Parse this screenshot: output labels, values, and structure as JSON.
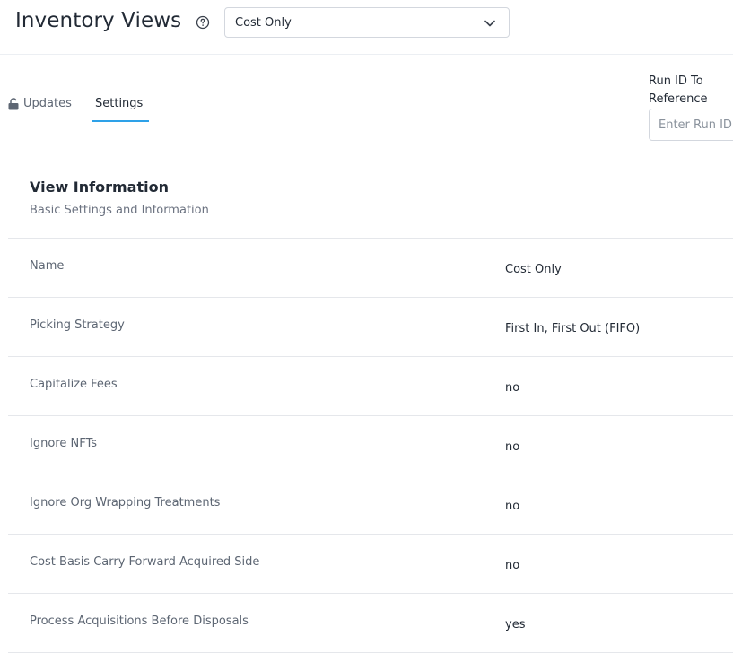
{
  "header": {
    "title": "Inventory Views",
    "help_icon": "question-circle-icon",
    "view_select": {
      "value": "Cost Only",
      "icon": "chevron-down-icon"
    }
  },
  "tabs": [
    {
      "label": "Updates",
      "icon": "lock-icon",
      "active": false
    },
    {
      "label": "Settings",
      "active": true
    }
  ],
  "run_id": {
    "label": "Run ID To Reference",
    "placeholder": "Enter Run ID"
  },
  "section": {
    "title": "View Information",
    "subtitle": "Basic Settings and Information"
  },
  "rows": [
    {
      "key": "Name",
      "value": "Cost Only"
    },
    {
      "key": "Picking Strategy",
      "value": "First In, First Out (FIFO)"
    },
    {
      "key": "Capitalize Fees",
      "value": "no"
    },
    {
      "key": "Ignore NFTs",
      "value": "no"
    },
    {
      "key": "Ignore Org Wrapping Treatments",
      "value": "no"
    },
    {
      "key": "Cost Basis Carry Forward Acquired Side",
      "value": "no"
    },
    {
      "key": "Process Acquisitions Before Disposals",
      "value": "yes"
    }
  ],
  "colors": {
    "accent": "#2ea1e8",
    "border": "#e5e7eb"
  }
}
